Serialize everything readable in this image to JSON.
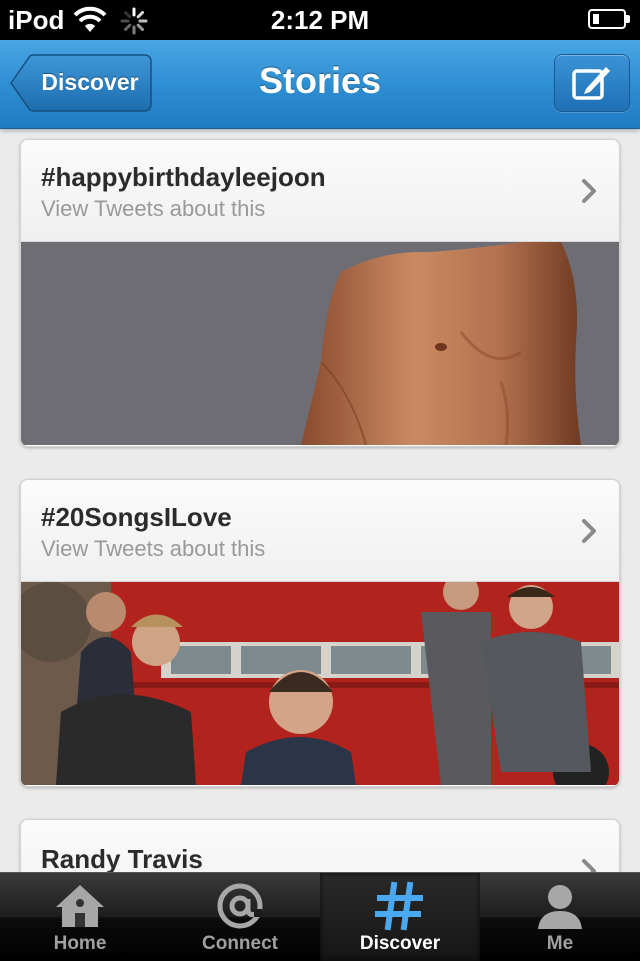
{
  "status_bar": {
    "carrier": "iPod",
    "time": "2:12 PM"
  },
  "nav": {
    "back_label": "Discover",
    "title": "Stories"
  },
  "stories": [
    {
      "title": "#happybirthdayleejoon",
      "subtitle": "View Tweets about this"
    },
    {
      "title": "#20SongsILove",
      "subtitle": "View Tweets about this"
    },
    {
      "title": "Randy Travis"
    }
  ],
  "tabs": [
    {
      "label": "Home",
      "icon": "home-icon"
    },
    {
      "label": "Connect",
      "icon": "at-icon"
    },
    {
      "label": "Discover",
      "icon": "hashtag-icon",
      "active": true
    },
    {
      "label": "Me",
      "icon": "person-icon"
    }
  ],
  "colors": {
    "nav_blue": "#2f8fd3",
    "active_tab_icon": "#4aa8f0"
  }
}
